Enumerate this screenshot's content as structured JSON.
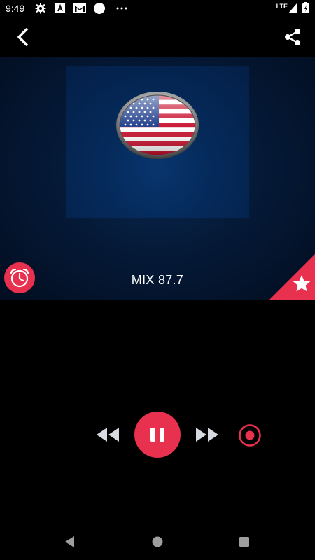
{
  "status_bar": {
    "time": "9:49",
    "network_label": "LTE",
    "icons": [
      "gear-icon",
      "a-icon",
      "gmail-icon",
      "circle-icon",
      "more-icon",
      "signal-icon",
      "battery-icon"
    ]
  },
  "app_bar": {
    "back_icon": "chevron-left-icon",
    "share_icon": "share-icon"
  },
  "player": {
    "station_name": "MIX 87.7",
    "artwork_icon": "us-flag-icon",
    "alarm_icon": "alarm-clock-icon",
    "favorite_icon": "star-icon"
  },
  "controls": {
    "rewind_icon": "rewind-icon",
    "play_pause_icon": "pause-icon",
    "forward_icon": "fast-forward-icon",
    "record_icon": "record-icon"
  },
  "nav_bar": {
    "icons": [
      "back-triangle-icon",
      "home-circle-icon",
      "recents-square-icon"
    ]
  },
  "colors": {
    "accent": "#e8304f",
    "background": "#000000",
    "hero_blue": "#052a5a"
  }
}
